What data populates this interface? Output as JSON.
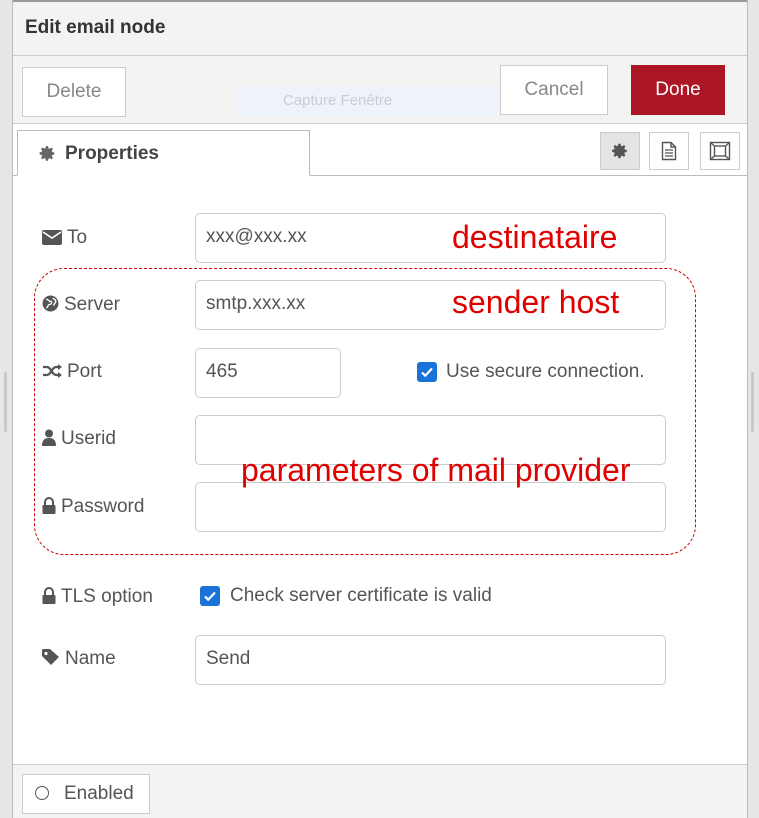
{
  "header": {
    "title": "Edit email node"
  },
  "toolbar": {
    "delete_label": "Delete",
    "cancel_label": "Cancel",
    "done_label": "Done",
    "ghost_text": "Capture Fenêtre",
    "done_color": "#ad1625"
  },
  "tabs": {
    "properties_label": "Properties",
    "icons": [
      "gear-icon",
      "document-icon",
      "frame-icon"
    ]
  },
  "form": {
    "to": {
      "label": "To",
      "value": "xxx@xxx.xx",
      "icon": "envelope-icon"
    },
    "server": {
      "label": "Server",
      "value": "smtp.xxx.xx",
      "icon": "globe-icon"
    },
    "port": {
      "label": "Port",
      "value": "465",
      "icon": "shuffle-icon"
    },
    "secure": {
      "label": "Use secure connection.",
      "checked": true
    },
    "userid": {
      "label": "Userid",
      "value": "",
      "icon": "user-icon"
    },
    "password": {
      "label": "Password",
      "value": "",
      "icon": "lock-icon"
    },
    "tls": {
      "label": "TLS option",
      "check_label": "Check server certificate is valid",
      "checked": true,
      "icon": "lock-icon"
    },
    "name": {
      "label": "Name",
      "value": "Send",
      "icon": "tag-icon"
    }
  },
  "annotations": {
    "to_note": "destinataire",
    "server_note": "sender host",
    "group_note": "parameters of mail provider",
    "color": "#e00000"
  },
  "footer": {
    "enabled_label": "Enabled"
  }
}
